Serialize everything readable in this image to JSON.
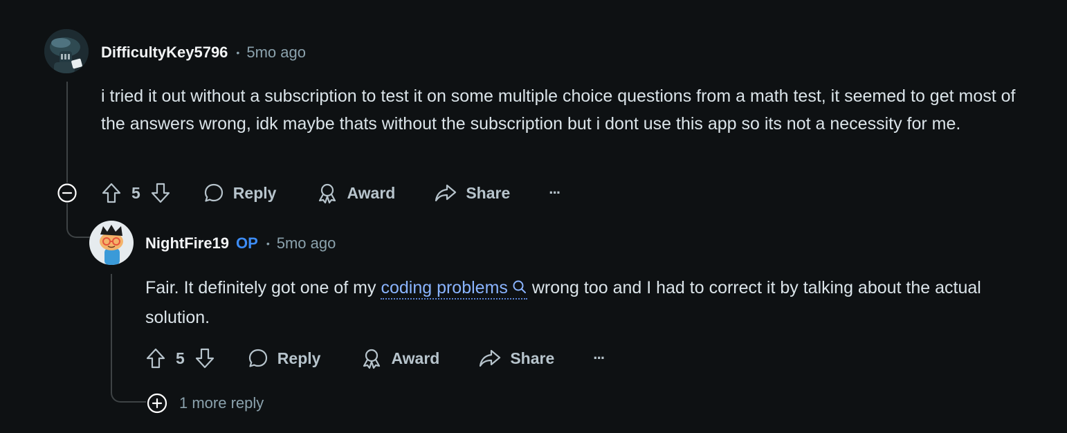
{
  "comment1": {
    "username": "DifficultyKey5796",
    "time": "5mo ago",
    "body": "i tried it out without a subscription to test it on some multiple choice questions from a math test, it seemed to get most of the answers wrong, idk maybe thats without the subscription but i dont use this app so its not a necessity for me.",
    "score": "5",
    "reply_label": "Reply",
    "award_label": "Award",
    "share_label": "Share",
    "more_label": "···"
  },
  "comment2": {
    "username": "NightFire19",
    "op_badge": "OP",
    "time": "5mo ago",
    "body_before": "Fair. It definitely got one of my ",
    "body_link": "coding problems",
    "body_after": " wrong too and I had to correct it by talking about the actual solution.",
    "score": "5",
    "reply_label": "Reply",
    "award_label": "Award",
    "share_label": "Share",
    "more_label": "···"
  },
  "more_replies": "1 more reply",
  "colors": {
    "background": "#0e1113",
    "username": "#f2f4f5",
    "op_badge": "#3d8cf5",
    "link": "#8ab4ff",
    "muted": "#8ba2ad",
    "thread_line": "#3e4345"
  },
  "icons": {
    "upvote": "upvote-arrow-icon",
    "downvote": "downvote-arrow-icon",
    "reply": "speech-bubble-icon",
    "award": "award-ribbon-icon",
    "share": "share-arrow-icon",
    "collapse": "minus-circle-icon",
    "expand": "plus-circle-icon",
    "search": "search-icon"
  }
}
